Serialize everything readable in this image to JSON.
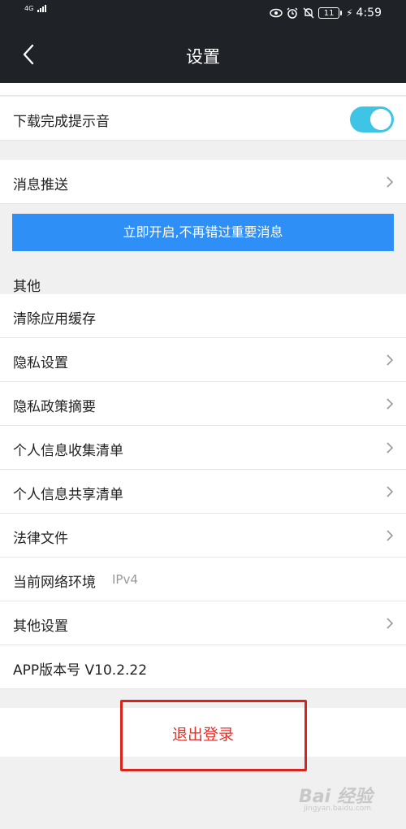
{
  "status_bar": {
    "network": "4G",
    "battery": "11",
    "time": "4:59",
    "icons": [
      "eye-icon",
      "alarm-icon",
      "mute-icon",
      "battery-icon",
      "charging-icon"
    ]
  },
  "header": {
    "title": "设置",
    "back_icon": "chevron-left-icon"
  },
  "download_sound": {
    "label": "下载完成提示音",
    "enabled": true,
    "accent": "#3ec5e6"
  },
  "push": {
    "label": "消息推送"
  },
  "banner": {
    "text": "立即开启,不再错过重要消息",
    "color": "#2e8ff7"
  },
  "other_section": {
    "title": "其他",
    "items": [
      {
        "label": "清除应用缓存"
      },
      {
        "label": "隐私设置"
      },
      {
        "label": "隐私政策摘要"
      },
      {
        "label": "个人信息收集清单"
      },
      {
        "label": "个人信息共享清单"
      },
      {
        "label": "法律文件"
      },
      {
        "label": "当前网络环境",
        "value": "IPv4"
      },
      {
        "label": "其他设置"
      },
      {
        "label": "APP版本号 V10.2.22"
      }
    ]
  },
  "logout": {
    "label": "退出登录",
    "color": "#e0332c"
  },
  "watermark": {
    "main": "Bai 经验",
    "sub": "jingyan.baidu.com"
  }
}
